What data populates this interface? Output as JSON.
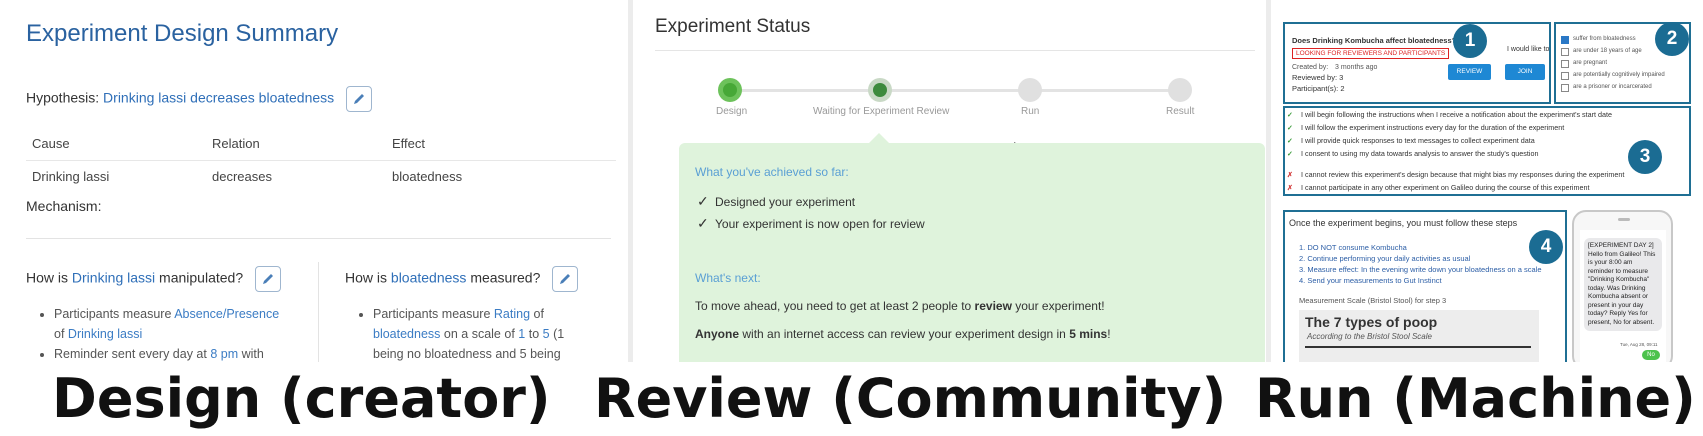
{
  "design": {
    "title": "Experiment Design Summary",
    "hypothesis_label": "Hypothesis:",
    "hypothesis": "Drinking lassi decreases bloatedness",
    "table": {
      "headers": [
        "Cause",
        "Relation",
        "Effect"
      ],
      "row": [
        "Drinking lassi",
        "decreases",
        "bloatedness"
      ]
    },
    "mechanism_label": "Mechanism:",
    "left": {
      "q_prefix": "How is",
      "q_var": "Drinking lassi",
      "q_suffix": "manipulated?",
      "b1_a": "Participants measure",
      "b1_link": "Absence/Presence",
      "b1_of": "of",
      "b1_var": "Drinking lassi",
      "b2_a": "Reminder sent every day at",
      "b2_time": "8 pm",
      "b2_b": "with"
    },
    "right": {
      "q_prefix": "How is",
      "q_var": "bloatedness",
      "q_suffix": "measured?",
      "b1_a": "Participants measure",
      "b1_link": "Rating",
      "b1_of": "of",
      "b1_var": "bloatedness",
      "b1_scale_a": "on a scale of",
      "b1_min": "1",
      "b1_to": "to",
      "b1_max": "5",
      "b1_paren": "(1",
      "b1_line3": "being no bloatedness and 5 being"
    }
  },
  "review": {
    "title": "Experiment Status",
    "steps": [
      {
        "label": "Design",
        "state": "done"
      },
      {
        "label": "Waiting for Experiment Review",
        "state": "current"
      },
      {
        "label": "Run",
        "state": "pending"
      },
      {
        "label": "Result",
        "state": "pending"
      }
    ],
    "achieved_heading": "What you've achieved so far:",
    "achieved": [
      "Designed your experiment",
      "Your experiment is now open for review"
    ],
    "next_heading": "What's next:",
    "next_a": "To move ahead, you need to get at least 2 people to",
    "next_bold": "review",
    "next_b": "your experiment!",
    "anyone_bold": "Anyone",
    "anyone_a": "with an internet access can review your experiment design in",
    "anyone_bold2": "5 mins",
    "anyone_b": "!"
  },
  "run": {
    "card": {
      "question": "Does Drinking Kombucha affect bloatedness?",
      "tag": "LOOKING FOR REVIEWERS AND PARTICIPANTS",
      "created_by": "Created by:",
      "created_ago": "3 months ago",
      "reviewed": "Reviewed by: 3",
      "participants": "Participant(s): 2",
      "would_like": "I would like to",
      "review_btn": "REVIEW",
      "join_btn": "JOIN"
    },
    "criteria": [
      {
        "text": "suffer from bloatedness",
        "checked": true
      },
      {
        "text": "are under 18 years of age",
        "checked": false
      },
      {
        "text": "are pregnant",
        "checked": false
      },
      {
        "text": "are potentially cognitively impaired",
        "checked": false
      },
      {
        "text": "are a prisoner or incarcerated",
        "checked": false
      }
    ],
    "agree": [
      "I will begin following the instructions when I receive a notification about the experiment's start date",
      "I will follow the experiment instructions every day for the duration of the experiment",
      "I will provide quick responses to text messages to collect experiment data",
      "I consent to using my data towards analysis to answer the study's question"
    ],
    "disagree": [
      "I cannot review this experiment's design because that might bias my responses during the experiment",
      "I cannot participate in any other experiment on Galileo during the course of this experiment"
    ],
    "steps_heading": "Once the experiment begins, you must follow these steps",
    "steps": [
      "1. DO NOT consume Kombucha",
      "2. Continue performing your daily activities as usual",
      "3. Measure effect: In the evening write down your bloatedness on a scale",
      "4. Send your measurements to Gut Instinct"
    ],
    "scale_label": "Measurement Scale (Bristol Stool) for step 3",
    "poop_title": "The 7 types of poop",
    "poop_sub": "According to the Bristol Stool Scale",
    "sms": "[EXPERIMENT DAY 2] Hello from Galileo! This is your 8:00 am reminder to measure \"Drinking Kombucha\" today. Was Drinking Kombucha absent or present in your day today? Reply Yes for present, No for absent.",
    "sms_time": "Tue, Aug 28, 09:11",
    "reply": "No",
    "badges": [
      "1",
      "2",
      "3",
      "4"
    ]
  },
  "captions": [
    "Design (creator)",
    "Review (Community)",
    "Run (Machine)"
  ]
}
